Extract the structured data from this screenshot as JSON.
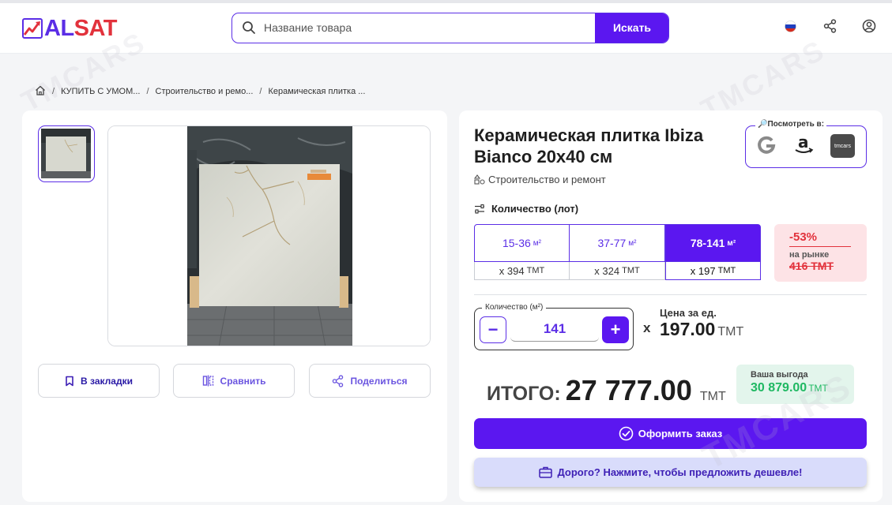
{
  "header": {
    "logo_part1": "AL",
    "logo_part2": "SAT",
    "search_placeholder": "Название товара",
    "search_button": "Искать",
    "language_icon": "ru-flag-icon",
    "share_icon": "share-icon",
    "profile_icon": "user-circle-icon"
  },
  "breadcrumb": {
    "home_icon": "home-icon",
    "items": [
      "КУПИТЬ С УМОМ...",
      "Строительство и ремо...",
      "Керамическая плитка ..."
    ]
  },
  "gallery": {
    "actions": {
      "bookmark": "В закладки",
      "compare": "Сравнить",
      "share": "Поделиться"
    }
  },
  "product": {
    "title": "Керамическая плитка Ibiza Bianco 20x40 см",
    "category": "Строительство и ремонт",
    "lookup_label": "🔎Посмотреть в:",
    "lookup_icons": [
      "google-icon",
      "amazon-icon",
      "tmcars-icon"
    ],
    "lookup_tmcars": "tmcars",
    "quantity_label": "Количество (лот)",
    "tiers": [
      {
        "range": "15-36",
        "unit": "м²",
        "price_prefix": "x",
        "price": "394",
        "currency": "ТМТ",
        "active": false
      },
      {
        "range": "37-77",
        "unit": "м²",
        "price_prefix": "x",
        "price": "324",
        "currency": "ТМТ",
        "active": false
      },
      {
        "range": "78-141",
        "unit": "м²",
        "price_prefix": "x",
        "price": "197",
        "currency": "ТМТ",
        "active": true
      }
    ],
    "discount": {
      "percent": "-53%",
      "market_label": "на рынке",
      "old_price": "416 ТМТ"
    },
    "stepper": {
      "label": "Количество (м²)",
      "minus": "−",
      "plus": "+",
      "value": "141"
    },
    "times_sign": "x",
    "unit_price_label": "Цена за ед.",
    "unit_price": "197.00",
    "unit_currency": "ТМТ",
    "total_label": "ИТОГО:",
    "total_value": "27 777.00",
    "total_currency": "ТМТ",
    "saving_label": "Ваша выгода",
    "saving_value": "30 879.00",
    "saving_currency": "ТМТ",
    "order_button": "Оформить заказ",
    "cheaper_button": "Дорого? Нажмите, чтобы предложить дешевле!"
  },
  "colors": {
    "brand": "#5b17f0",
    "accent_red": "#e2323c",
    "saving_green": "#1fb862"
  }
}
